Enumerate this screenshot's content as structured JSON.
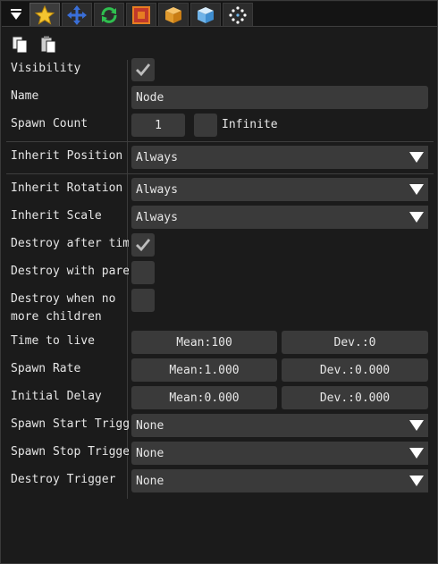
{
  "tabs": [
    {
      "name": "star",
      "icon": "star-icon"
    },
    {
      "name": "move",
      "icon": "move-icon"
    },
    {
      "name": "refresh",
      "icon": "refresh-icon"
    },
    {
      "name": "scale",
      "icon": "scale-icon"
    },
    {
      "name": "box",
      "icon": "box-icon"
    },
    {
      "name": "cube",
      "icon": "cube-icon"
    },
    {
      "name": "particles",
      "icon": "particles-icon"
    }
  ],
  "toolbar": {
    "copy_icon": "copy-icon",
    "paste_icon": "paste-icon"
  },
  "props": {
    "visibility": {
      "label": "Visibility",
      "checked": true
    },
    "name": {
      "label": "Name",
      "value": "Node"
    },
    "spawn_count": {
      "label": "Spawn Count",
      "value": "1",
      "infinite_label": "Infinite",
      "infinite_checked": false
    },
    "inherit_position": {
      "label": "Inherit Position",
      "value": "Always"
    },
    "inherit_rotation": {
      "label": "Inherit Rotation",
      "value": "Always"
    },
    "inherit_scale": {
      "label": "Inherit Scale",
      "value": "Always"
    },
    "destroy_after_time": {
      "label": "Destroy after time",
      "checked": true
    },
    "destroy_with_parent": {
      "label": "Destroy with paren",
      "checked": false
    },
    "destroy_no_children": {
      "label_line1": "Destroy when no",
      "label_line2": "more children",
      "checked": false
    },
    "time_to_live": {
      "label": "Time to live",
      "mean": "Mean:100",
      "dev": "Dev.:0"
    },
    "spawn_rate": {
      "label": "Spawn Rate",
      "mean": "Mean:1.000",
      "dev": "Dev.:0.000"
    },
    "initial_delay": {
      "label": "Initial Delay",
      "mean": "Mean:0.000",
      "dev": "Dev.:0.000"
    },
    "spawn_start_trigger": {
      "label": "Spawn Start Trigge",
      "value": "None"
    },
    "spawn_stop_trigger": {
      "label": "Spawn Stop Trigger",
      "value": "None"
    },
    "destroy_trigger": {
      "label": "Destroy Trigger",
      "value": "None"
    }
  }
}
